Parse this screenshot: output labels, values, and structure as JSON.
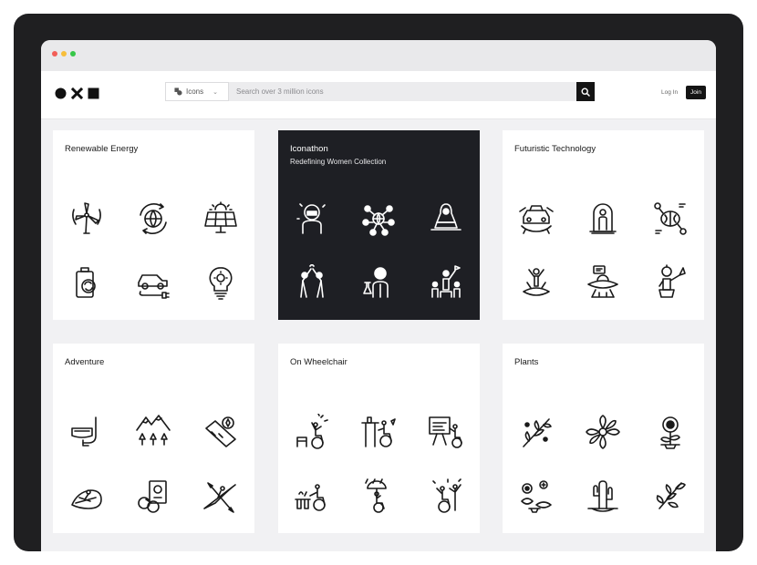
{
  "window": {
    "controls": [
      "close",
      "minimize",
      "maximize"
    ]
  },
  "header": {
    "logo_icons": [
      "circle-icon",
      "x-icon",
      "square-icon"
    ],
    "type_select": {
      "label": "Icons"
    },
    "search": {
      "placeholder": "Search over 3 million icons"
    },
    "login_label": "Log In",
    "join_label": "Join"
  },
  "colors": {
    "accent_dark": "#141414",
    "card_dark": "#1e1f24",
    "page_bg": "#f1f1f3"
  },
  "collections": [
    {
      "title": "Renewable Energy",
      "subtitle": "",
      "theme": "light",
      "icons": [
        "wind-turbine-icon",
        "globe-recycle-icon",
        "solar-panel-icon",
        "battery-charge-icon",
        "electric-car-icon",
        "eco-bulb-icon"
      ]
    },
    {
      "title": "Iconathon",
      "subtitle": "Redefining Women Collection",
      "theme": "dark",
      "icons": [
        "astronaut-woman-icon",
        "network-people-icon",
        "woman-laptop-icon",
        "high-five-icon",
        "scientist-woman-icon",
        "leader-group-icon"
      ]
    },
    {
      "title": "Futuristic Technology",
      "subtitle": "",
      "theme": "light",
      "icons": [
        "flying-car-icon",
        "teleport-capsule-icon",
        "brain-chip-icon",
        "hologram-person-icon",
        "ufo-icon",
        "robot-icon"
      ]
    },
    {
      "title": "Adventure",
      "subtitle": "",
      "theme": "light",
      "icons": [
        "snorkel-mask-icon",
        "mountains-forest-icon",
        "map-compass-icon",
        "surfing-icon",
        "passport-binoculars-icon",
        "kayak-icon"
      ]
    },
    {
      "title": "On Wheelchair",
      "subtitle": "",
      "theme": "light",
      "icons": [
        "wheelchair-celebrate-icon",
        "wheelchair-bar-icon",
        "wheelchair-presentation-icon",
        "wheelchair-cooking-icon",
        "wheelchair-rain-icon",
        "wheelchair-party-icon"
      ]
    },
    {
      "title": "Plants",
      "subtitle": "",
      "theme": "light",
      "icons": [
        "branch-leaves-icon",
        "flower-icon",
        "sunflower-icon",
        "succulents-icon",
        "cactus-icon",
        "twig-icon"
      ]
    }
  ]
}
